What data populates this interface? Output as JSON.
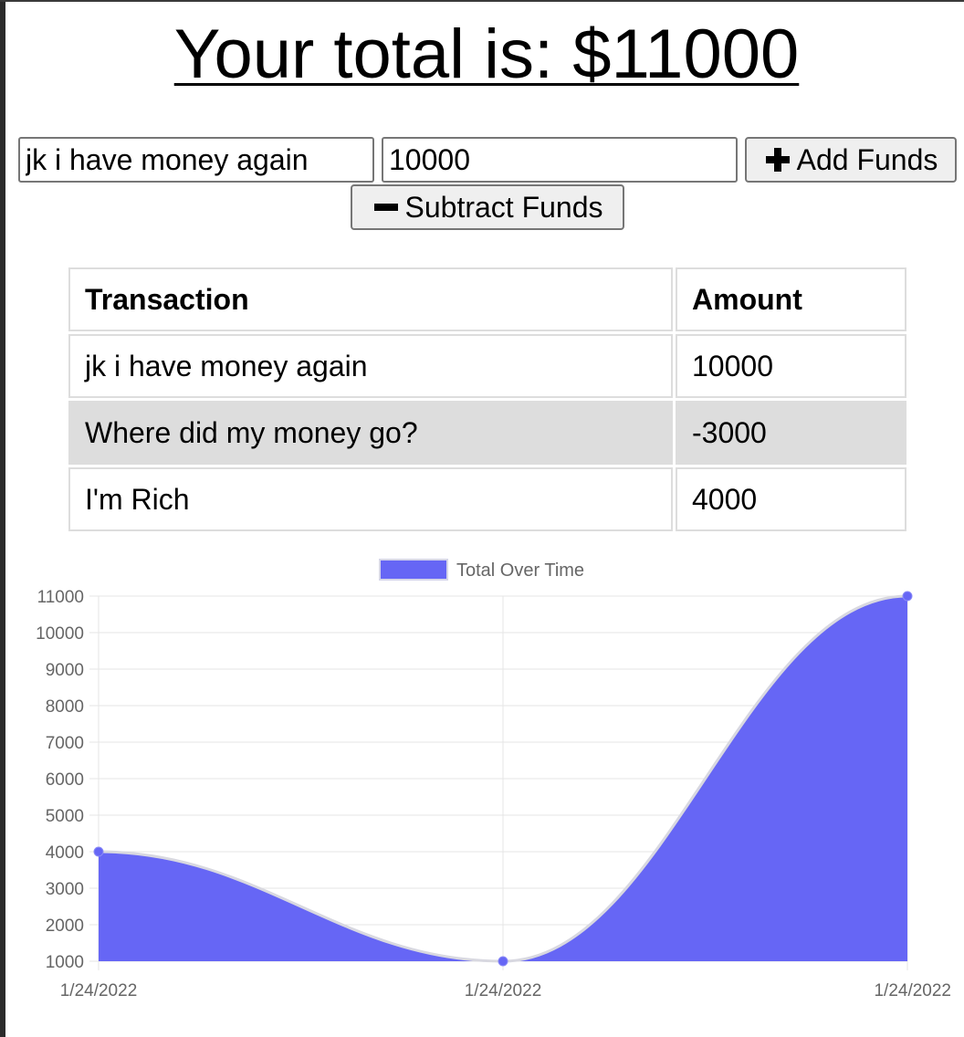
{
  "header": {
    "title": "Your total is: $11000"
  },
  "form": {
    "name_value": "jk i have money again",
    "amount_value": "10000",
    "add_label": "Add Funds",
    "subtract_label": "Subtract Funds"
  },
  "table": {
    "headers": [
      "Transaction",
      "Amount"
    ],
    "rows": [
      {
        "name": "jk i have money again",
        "amount": "10000"
      },
      {
        "name": "Where did my money go?",
        "amount": "-3000"
      },
      {
        "name": "I'm Rich",
        "amount": "4000"
      }
    ]
  },
  "icons": {
    "add": "plus-icon",
    "subtract": "minus-icon"
  },
  "colors": {
    "series_fill": "#6666f5",
    "grid": "#e5e5e5",
    "tick_text": "#666666"
  },
  "chart_data": {
    "type": "area",
    "x": [
      "1/24/2022",
      "1/24/2022",
      "1/24/2022"
    ],
    "series": [
      {
        "name": "Total Over Time",
        "values": [
          4000,
          1000,
          11000
        ]
      }
    ],
    "ylim": [
      1000,
      11000
    ],
    "yticks": [
      1000,
      2000,
      3000,
      4000,
      5000,
      6000,
      7000,
      8000,
      9000,
      10000,
      11000
    ],
    "grid": true,
    "legend": "top-center"
  }
}
